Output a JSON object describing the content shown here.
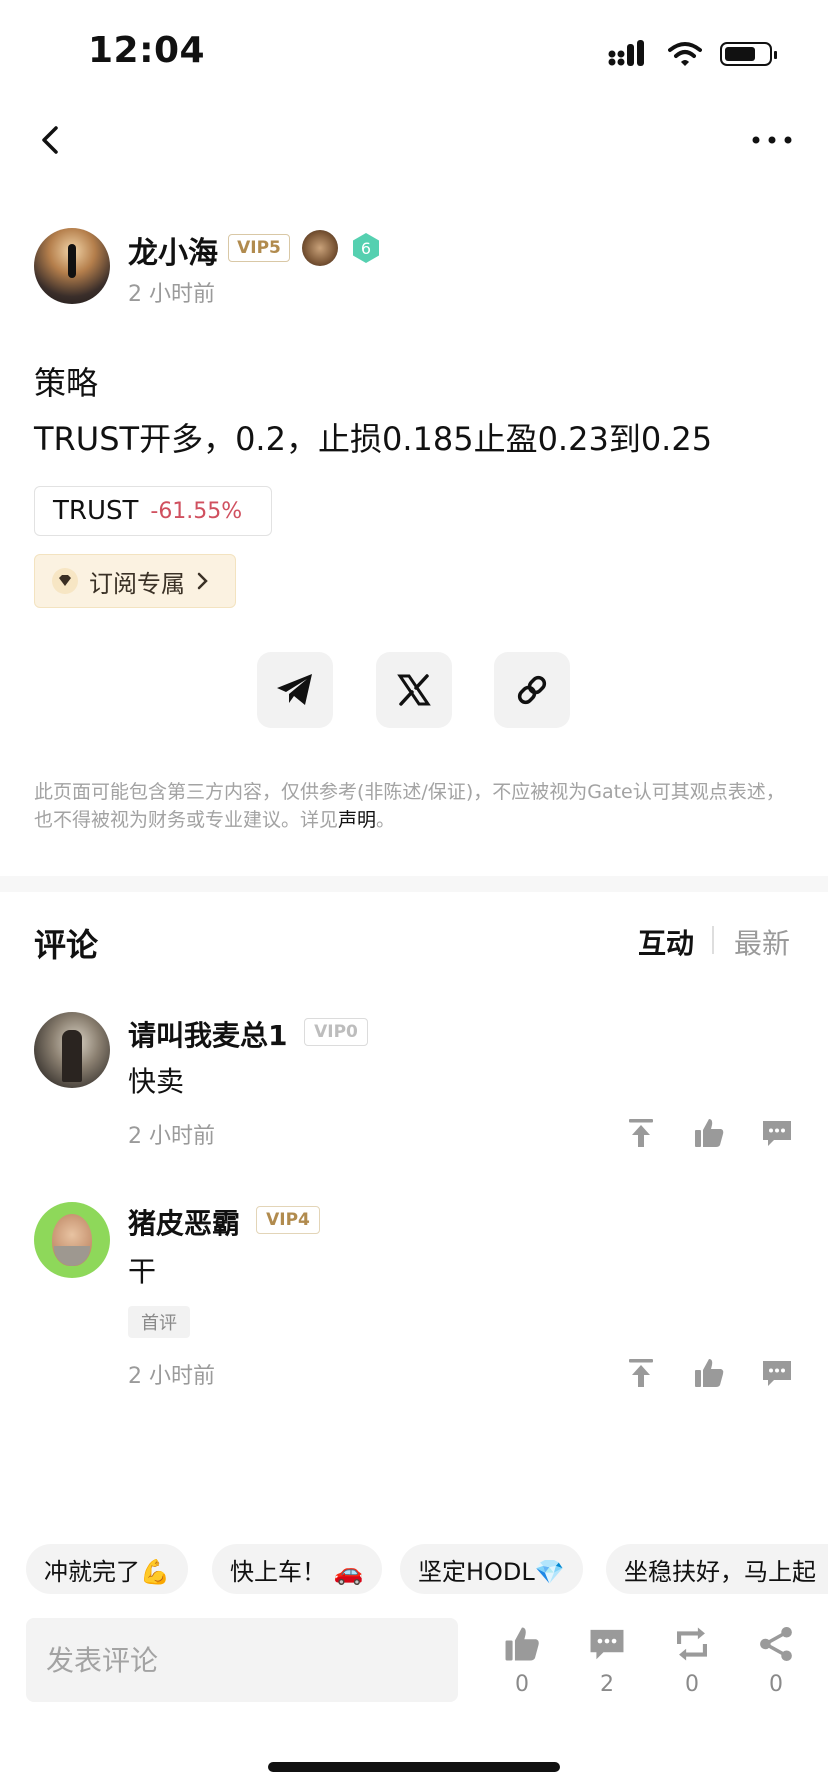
{
  "status_bar": {
    "time": "12:04"
  },
  "post": {
    "author": {
      "name": "龙小海",
      "vip": "VIP5",
      "level": "6"
    },
    "time": "2 小时前",
    "title": "策略",
    "body": "TRUST开多，0.2，止损0.185止盈0.23到0.25",
    "coin": {
      "symbol": "TRUST",
      "change": "-61.55%"
    },
    "subscribe_label": "订阅专属",
    "disclaimer": {
      "text": "此页面可能包含第三方内容，仅供参考(非陈述/保证)，不应被视为Gate认可其观点表述，也不得被视为财务或专业建议。详见",
      "link": "声明",
      "suffix": "。"
    }
  },
  "comments_section": {
    "title": "评论",
    "tabs": [
      "互动",
      "最新"
    ],
    "comments": [
      {
        "name": "请叫我麦总1",
        "vip": "VIP0",
        "text": "快卖",
        "time": "2 小时前"
      },
      {
        "name": "猪皮恶霸",
        "vip": "VIP4",
        "text": "干",
        "tag": "首评",
        "time": "2 小时前"
      }
    ]
  },
  "quick_replies": [
    "冲就完了💪",
    "快上车！ 🚗",
    "坚定HODL💎",
    "坐稳扶好，马上起"
  ],
  "bottom_bar": {
    "placeholder": "发表评论",
    "like_count": "0",
    "comment_count": "2",
    "repost_count": "0",
    "share_count": "0"
  },
  "colors": {
    "accent_down": "#d0505f",
    "vip_gold": "#b18b4e",
    "muted": "#9a9a9a"
  }
}
